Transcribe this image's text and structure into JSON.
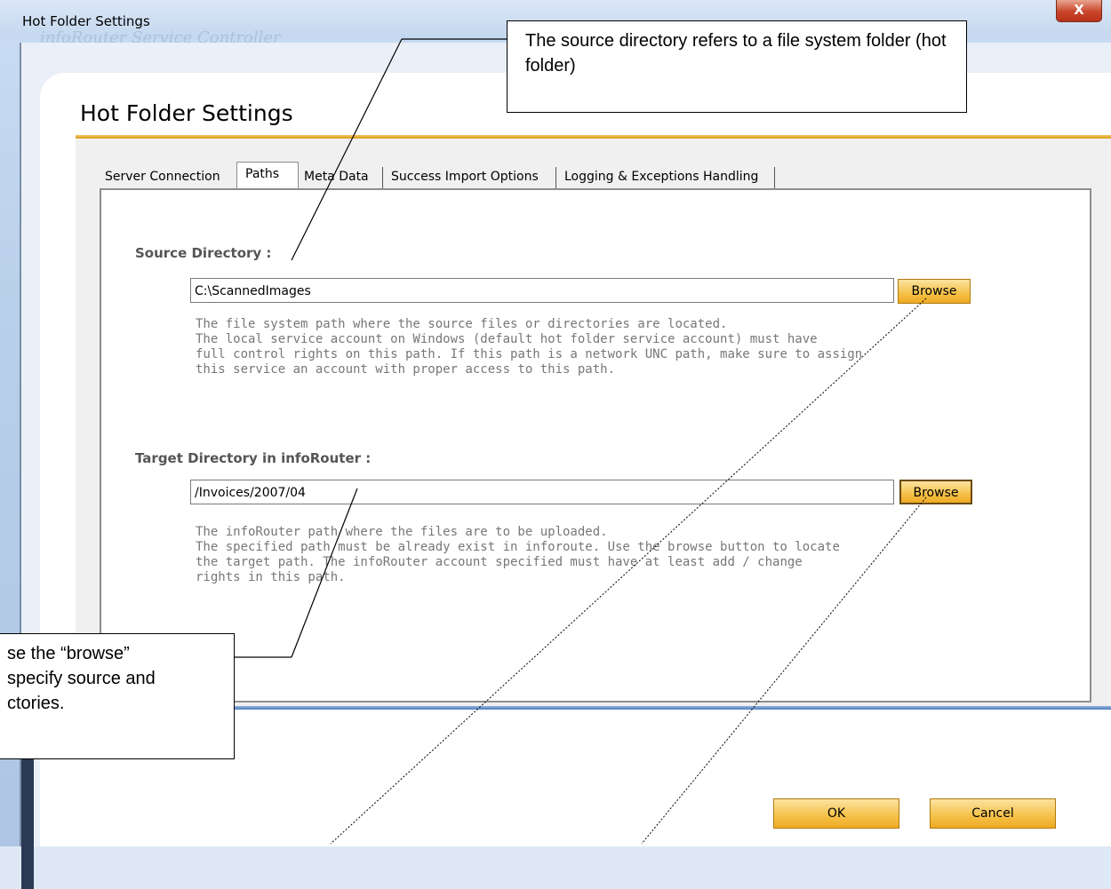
{
  "window": {
    "title": "Hot Folder Settings",
    "close_label": "X",
    "background_ghost": "infoRouter Service Controller"
  },
  "page_title": "Hot Folder Settings",
  "tabs": [
    {
      "label": "Server Connection"
    },
    {
      "label": "Paths",
      "active": true
    },
    {
      "label": "Meta Data"
    },
    {
      "label": "Success Import Options"
    },
    {
      "label": "Logging & Exceptions Handling"
    }
  ],
  "source": {
    "label": "Source Directory :",
    "value": "C:\\ScannedImages",
    "browse_label": "Browse",
    "help": "The file system path where the source files or directories are located.\nThe local service account on Windows (default hot folder service account) must have\nfull control rights on this path. If this path is a network UNC path, make sure to assign\nthis service an account with proper access to this path."
  },
  "target": {
    "label": "Target Directory in infoRouter :",
    "value": "/Invoices/2007/04",
    "browse_label": "Browse",
    "help": "The infoRouter path where the files are to be uploaded.\nThe specified path must be already exist in inforoute. Use the browse button to locate\nthe target path. The infoRouter account specified must have at least add / change\nrights in this path."
  },
  "buttons": {
    "ok": "OK",
    "cancel": "Cancel"
  },
  "callouts": {
    "top": "The source directory refers to a file system folder (hot folder)",
    "left": "se the “browse”\nspecify source and\nctories."
  },
  "colors": {
    "accent_gold": "#f5c148",
    "label_gray": "#555555",
    "help_gray": "#777777"
  }
}
